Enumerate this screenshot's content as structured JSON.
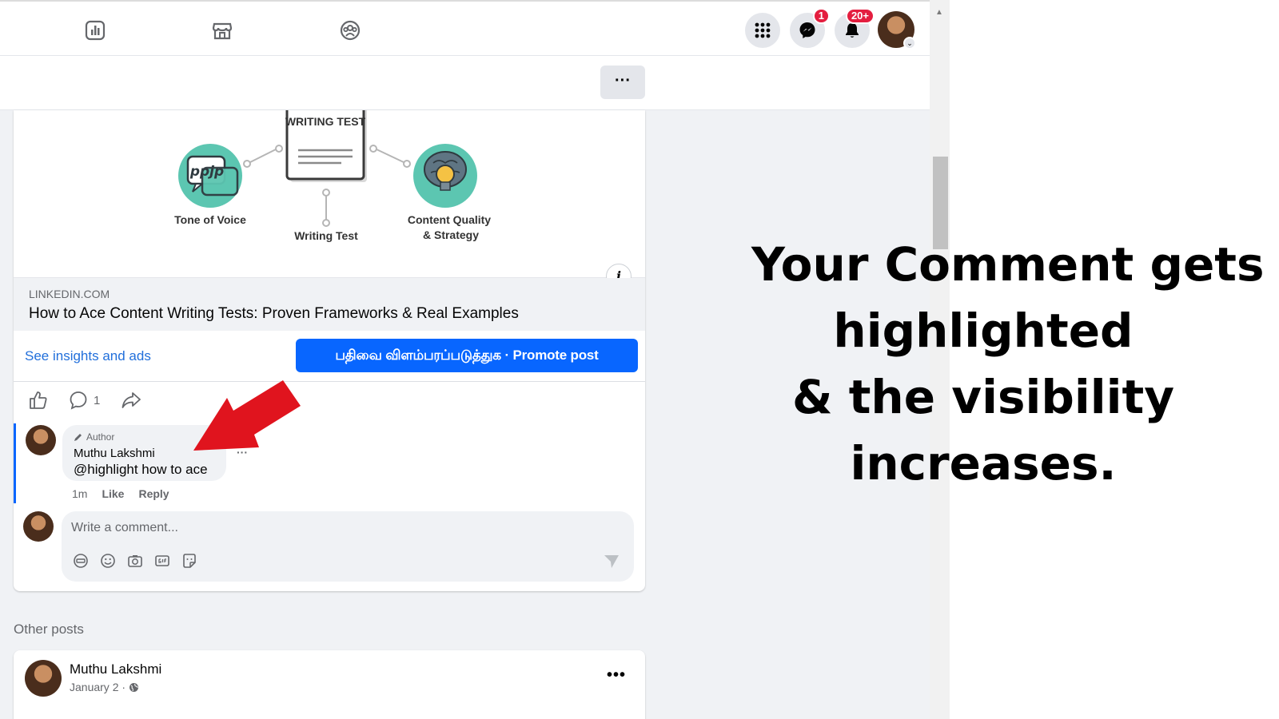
{
  "topnav": {
    "icons": [
      "insights-icon",
      "marketplace-icon",
      "groups-icon"
    ],
    "messenger_badge": "1",
    "notifications_badge": "20+"
  },
  "link_preview": {
    "image": {
      "center_title": "WRITING TEST",
      "left_label": "Tone of Voice",
      "left_bubble_text": "ppjp",
      "center_label": "Writing Test",
      "right_label_line1": "Content Quality",
      "right_label_line2": "& Strategy"
    },
    "domain": "LINKEDIN.COM",
    "title": "How to Ace Content Writing Tests: Proven Frameworks & Real Examples"
  },
  "post_actions": {
    "insights_link": "See insights and ads",
    "promote_button": "பதிவை விளம்பரப்படுத்துக · Promote post",
    "comment_count": "1"
  },
  "comment": {
    "author_tag": "Author",
    "name": "Muthu Lakshmi",
    "text": "@highlight how to ace",
    "time": "1m",
    "like": "Like",
    "reply": "Reply",
    "more": "···"
  },
  "composer": {
    "placeholder": "Write a comment..."
  },
  "other_posts": {
    "heading": "Other posts",
    "post": {
      "name": "Muthu Lakshmi",
      "date": "January 2 ·",
      "more": "•••"
    }
  },
  "caption": {
    "line1": "Your Comment gets",
    "line2": "highlighted",
    "line3": "& the visibility",
    "line4": "increases."
  },
  "colors": {
    "brand_blue": "#0866ff",
    "link_blue": "#216fdb",
    "arrow_red": "#e0141e",
    "badge_red": "#e41e3f",
    "teal": "#5cc6b1"
  }
}
